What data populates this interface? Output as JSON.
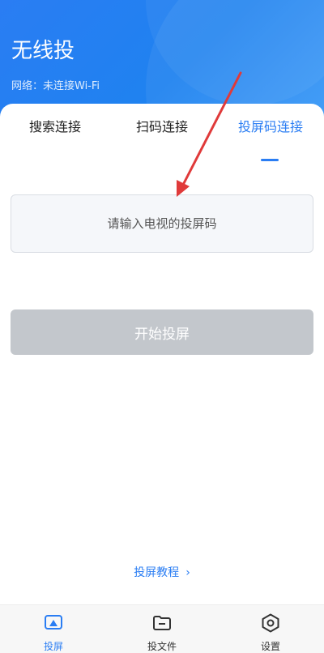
{
  "header": {
    "title": "无线投",
    "network_status": "网络：未连接Wi-Fi"
  },
  "tabs": [
    {
      "label": "搜索连接",
      "active": false
    },
    {
      "label": "扫码连接",
      "active": false
    },
    {
      "label": "投屏码连接",
      "active": true
    }
  ],
  "code_input": {
    "placeholder": "请输入电视的投屏码",
    "value": ""
  },
  "start_button": {
    "label": "开始投屏"
  },
  "tutorial_link": {
    "label": "投屏教程"
  },
  "bottom_nav": [
    {
      "label": "投屏",
      "icon": "cast-icon",
      "active": true
    },
    {
      "label": "投文件",
      "icon": "folder-icon",
      "active": false
    },
    {
      "label": "设置",
      "icon": "settings-icon",
      "active": false
    }
  ],
  "colors": {
    "accent": "#2a7df3",
    "header_bg": "#1f82f0",
    "button_disabled": "#c3c7cc",
    "annotation_arrow": "#e03a3a"
  }
}
